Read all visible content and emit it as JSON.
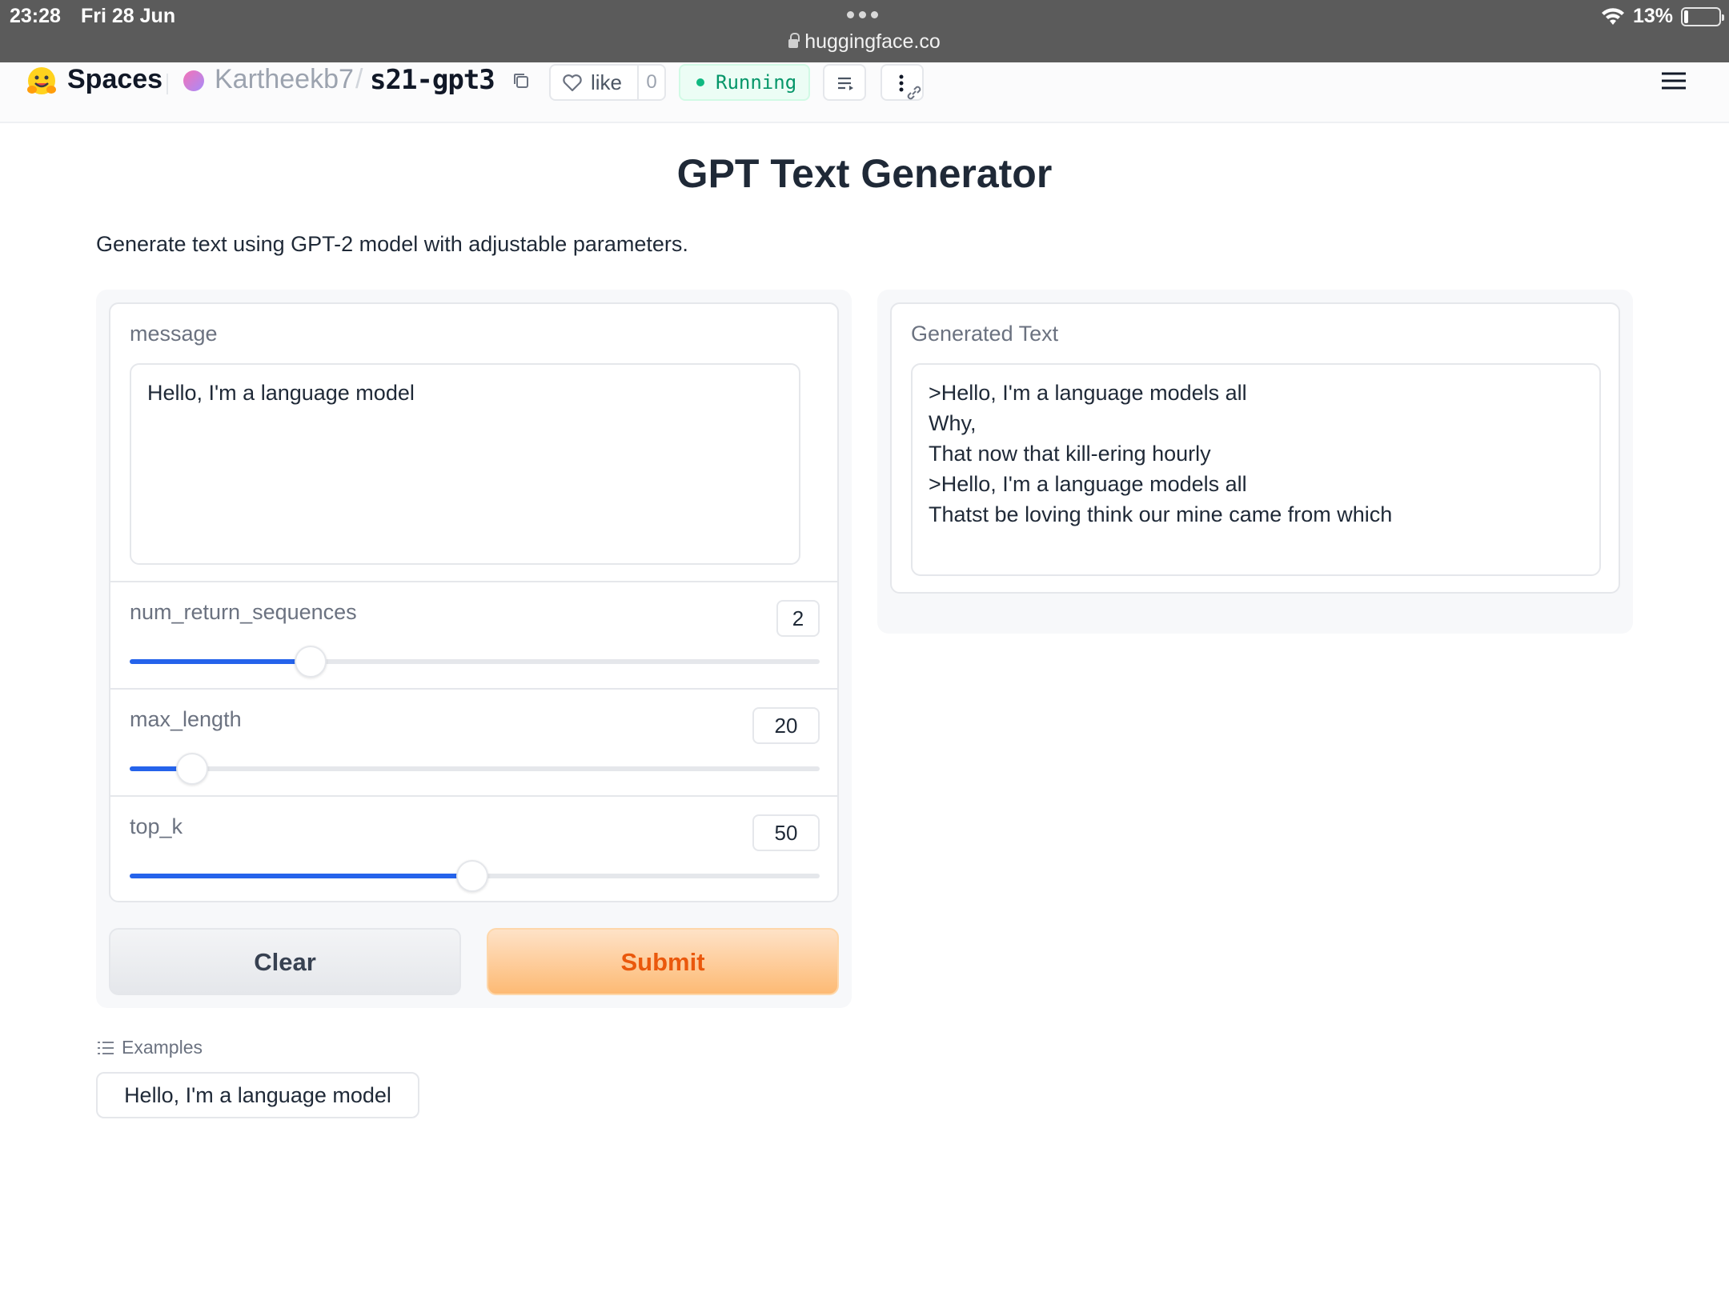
{
  "status_bar": {
    "time": "23:28",
    "date": "Fri 28 Jun",
    "battery_percent_text": "13%",
    "battery_level": 0.13,
    "url": "huggingface.co"
  },
  "header": {
    "brand": "Spaces",
    "owner": "Kartheekb7",
    "separator": "/",
    "repo": "s21-gpt3",
    "like_label": "like",
    "like_count": "0",
    "status": "Running",
    "status_color": "#10b981"
  },
  "app": {
    "title": "GPT Text Generator",
    "description": "Generate text using GPT-2 model with adjustable parameters."
  },
  "inputs": {
    "message_label": "message",
    "message_value": "Hello, I'm a language model",
    "sliders": [
      {
        "label": "num_return_sequences",
        "value": "2",
        "fill_fraction": 0.262
      },
      {
        "label": "max_length",
        "value": "20",
        "fill_fraction": 0.091
      },
      {
        "label": "top_k",
        "value": "50",
        "fill_fraction": 0.496
      }
    ],
    "clear_label": "Clear",
    "submit_label": "Submit"
  },
  "output": {
    "label": "Generated Text",
    "value": ">Hello, I'm a language models all\nWhy,\nThat now that kill-ering hourly\n>Hello, I'm a language models all\nThatst be loving think our mine came from which"
  },
  "examples": {
    "heading": "Examples",
    "items": [
      "Hello, I'm a language model"
    ]
  },
  "colors": {
    "accent_blue": "#2563eb",
    "submit_text": "#ea580c",
    "running_green": "#059669"
  }
}
